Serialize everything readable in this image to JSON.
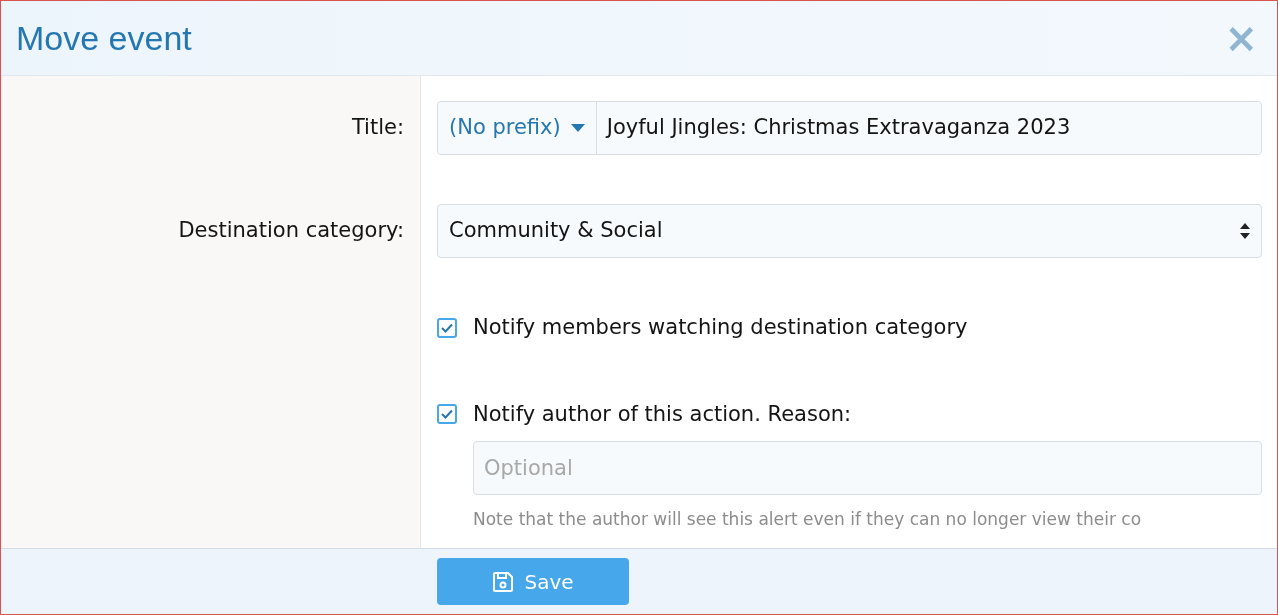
{
  "dialog": {
    "title": "Move event",
    "close_label": "×"
  },
  "fields": [
    {
      "kind": "prefixed",
      "label": "Title:",
      "prefix": "(No prefix)",
      "value": "Joyful Jingles: Christmas Extravaganza 2023"
    },
    {
      "kind": "select",
      "label": "Destination category:",
      "value": "Community & Social"
    }
  ],
  "options": [
    {
      "label": "Notify members watching destination category",
      "checked": true
    },
    {
      "label": "Notify author of this action. Reason:",
      "checked": true,
      "placeholder": "Optional",
      "note": "Note that the author will see this alert even if they can no longer view their co"
    }
  ],
  "footer": {
    "button": "Save"
  }
}
